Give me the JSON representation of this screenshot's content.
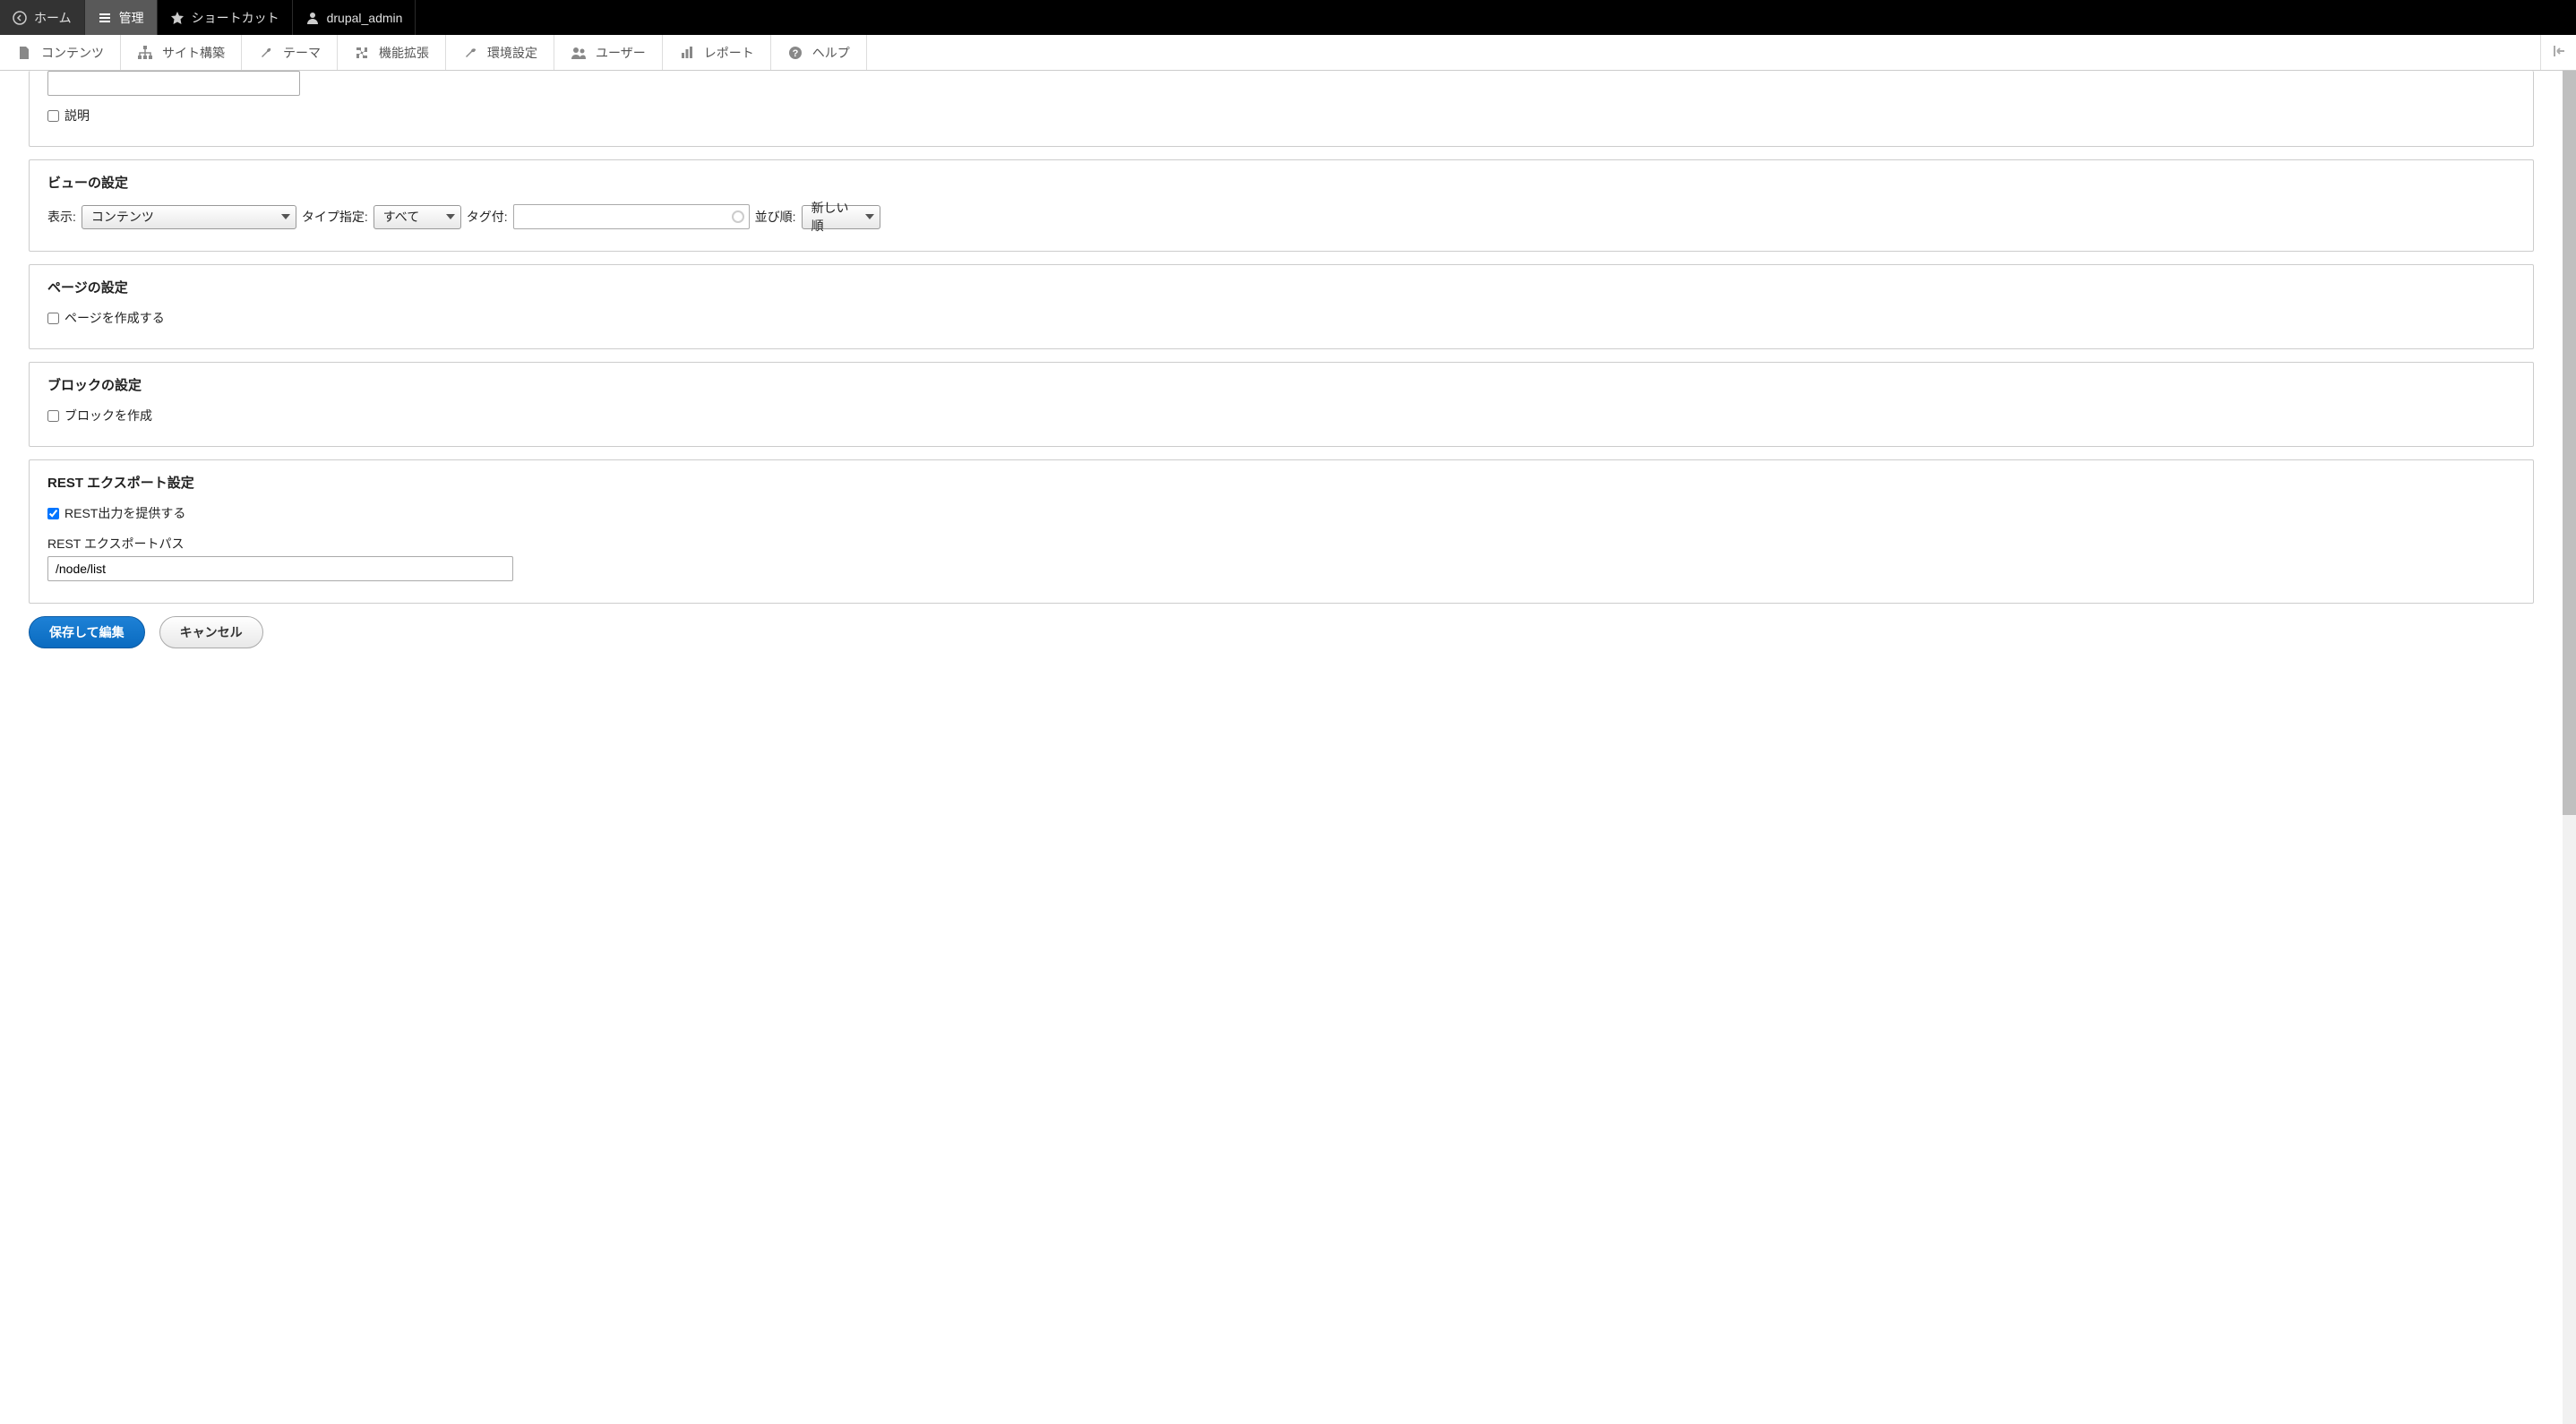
{
  "toolbar_black": {
    "home": "ホーム",
    "manage": "管理",
    "shortcut": "ショートカット",
    "user": "drupal_admin"
  },
  "toolbar_white": {
    "content": "コンテンツ",
    "structure": "サイト構築",
    "appearance": "テーマ",
    "extend": "機能拡張",
    "config": "環境設定",
    "people": "ユーザー",
    "reports": "レポート",
    "help": "ヘルプ"
  },
  "top_panel": {
    "text_value": "",
    "description_label": "説明",
    "description_checked": false
  },
  "view_settings": {
    "legend": "ビューの設定",
    "show_label": "表示:",
    "show_value": "コンテンツ",
    "type_label": "タイプ指定:",
    "type_value": "すべて",
    "tag_label": "タグ付:",
    "tag_value": "",
    "sort_label": "並び順:",
    "sort_value": "新しい順"
  },
  "page_settings": {
    "legend": "ページの設定",
    "create_page_label": "ページを作成する",
    "create_page_checked": false
  },
  "block_settings": {
    "legend": "ブロックの設定",
    "create_block_label": "ブロックを作成",
    "create_block_checked": false
  },
  "rest_settings": {
    "legend": "REST エクスポート設定",
    "provide_label": "REST出力を提供する",
    "provide_checked": true,
    "path_label": "REST エクスポートパス",
    "path_value": "/node/list"
  },
  "buttons": {
    "save": "保存して編集",
    "cancel": "キャンセル"
  }
}
